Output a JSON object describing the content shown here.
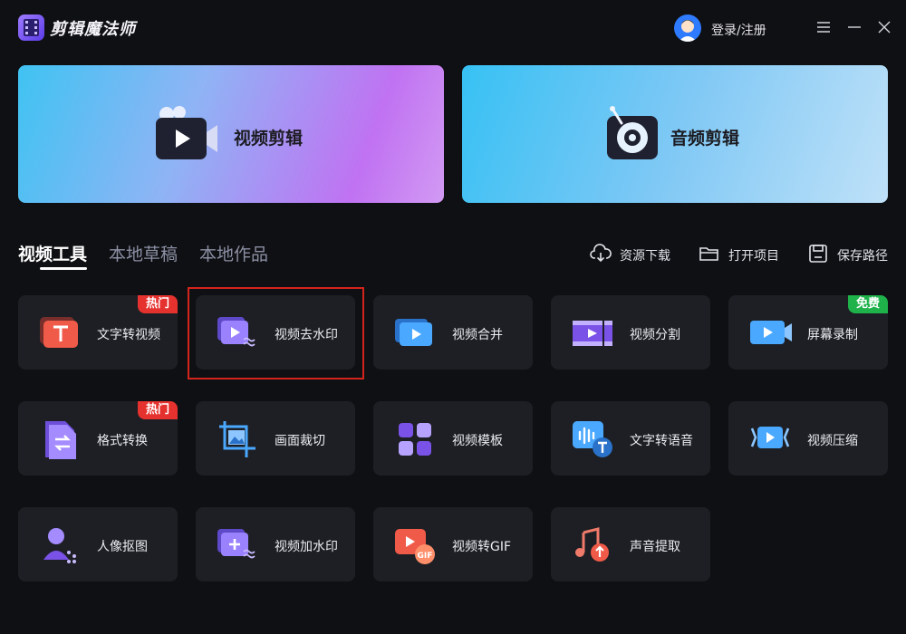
{
  "app": {
    "title": "剪辑魔法师"
  },
  "user": {
    "login_label": "登录/注册"
  },
  "window_controls": [
    "menu-icon",
    "minimize-icon",
    "close-icon"
  ],
  "hero": {
    "video": {
      "label": "视频剪辑",
      "icon": "video-camera-icon"
    },
    "audio": {
      "label": "音频剪辑",
      "icon": "record-disc-icon"
    }
  },
  "tabs": [
    {
      "label": "视频工具",
      "active": true
    },
    {
      "label": "本地草稿",
      "active": false
    },
    {
      "label": "本地作品",
      "active": false
    }
  ],
  "actions": [
    {
      "label": "资源下载",
      "icon": "download-cloud-icon"
    },
    {
      "label": "打开项目",
      "icon": "folder-icon"
    },
    {
      "label": "保存路径",
      "icon": "save-disk-icon"
    }
  ],
  "tools": [
    {
      "label": "文字转视频",
      "badge": "热门",
      "icon": "text-to-video-icon"
    },
    {
      "label": "视频去水印",
      "icon": "remove-watermark-icon",
      "highlighted": true
    },
    {
      "label": "视频合并",
      "icon": "video-merge-icon"
    },
    {
      "label": "视频分割",
      "icon": "video-split-icon"
    },
    {
      "label": "屏幕录制",
      "badge": "免费",
      "icon": "screen-record-icon"
    },
    {
      "label": "格式转换",
      "badge": "热门",
      "icon": "format-convert-icon"
    },
    {
      "label": "画面裁切",
      "icon": "crop-icon"
    },
    {
      "label": "视频模板",
      "icon": "template-icon"
    },
    {
      "label": "文字转语音",
      "icon": "text-to-speech-icon"
    },
    {
      "label": "视频压缩",
      "icon": "compress-icon"
    },
    {
      "label": "人像抠图",
      "icon": "portrait-cutout-icon"
    },
    {
      "label": "视频加水印",
      "icon": "add-watermark-icon"
    },
    {
      "label": "视频转GIF",
      "icon": "video-to-gif-icon"
    },
    {
      "label": "声音提取",
      "icon": "audio-extract-icon"
    }
  ],
  "colors": {
    "background": "#0f1013",
    "card": "#1d1f24",
    "hot_badge": "#e6322e",
    "free_badge": "#1fb24a",
    "highlight": "#d3241d"
  }
}
